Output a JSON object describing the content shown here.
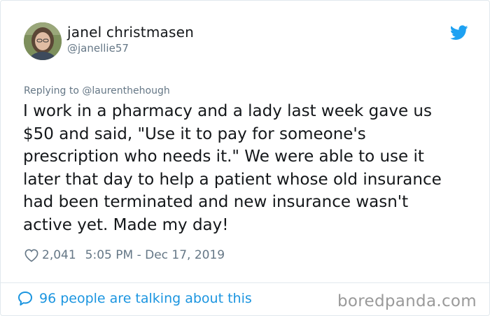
{
  "tweet": {
    "author_name": "janel christmasen",
    "author_handle": "@janellie57",
    "replying_prefix": "Replying to",
    "replying_to": "@laurenthehough",
    "text": "I work in a pharmacy and a lady last week gave us\n$50 and said, \"Use it to pay for someone's\nprescription who needs it.\" We were able to use it\nlater that day to help a patient whose old insurance\nhad been terminated and new insurance wasn't\nactive yet. Made my day!",
    "likes": "2,041",
    "timestamp": "5:05 PM - Dec 17, 2019",
    "talking": "96 people are talking about this"
  },
  "watermark": "boredpanda.com",
  "icons": {
    "brand": "twitter-bird-icon",
    "like": "heart-icon",
    "reply": "speech-bubble-icon"
  },
  "colors": {
    "twitter_blue": "#1da1f2",
    "link_blue": "#1b95e0",
    "text": "#14171a",
    "muted": "#657786",
    "watermark": "#9a9a9a"
  }
}
